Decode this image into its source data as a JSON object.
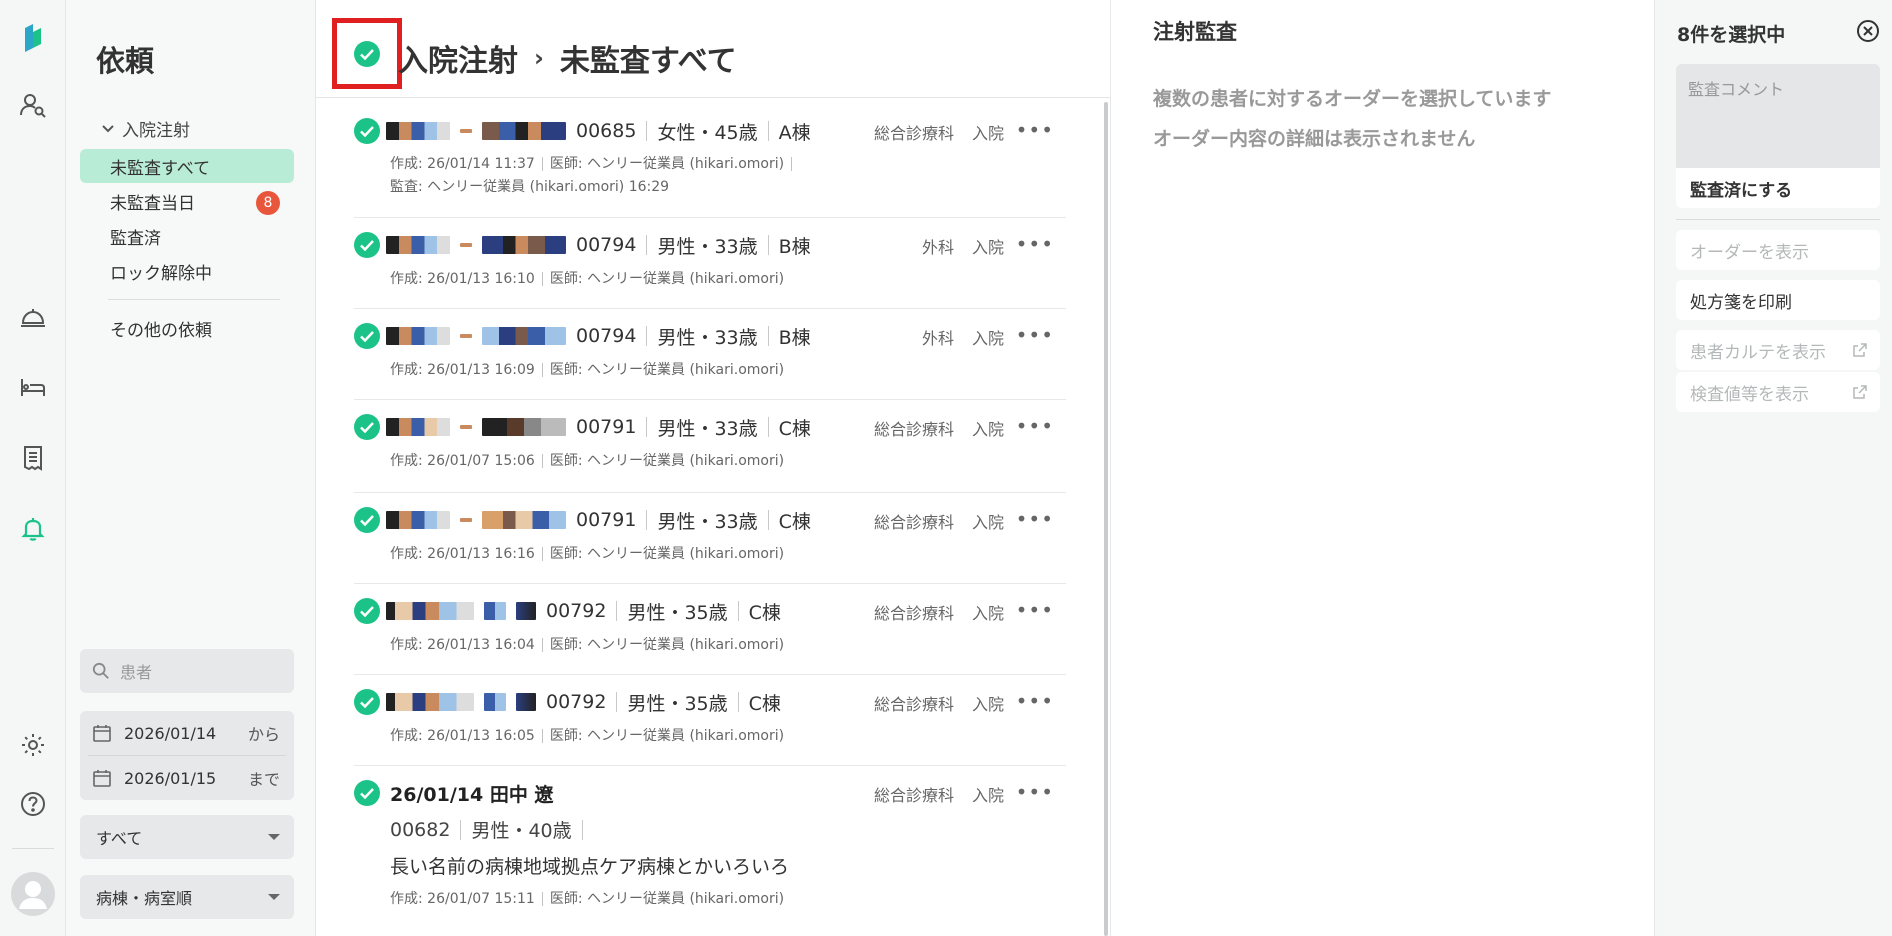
{
  "nav": {
    "title": "依頼",
    "group_label": "入院注射",
    "items": [
      {
        "label": "未監査すべて",
        "badge": null
      },
      {
        "label": "未監査当日",
        "badge": "8"
      },
      {
        "label": "監査済",
        "badge": null
      },
      {
        "label": "ロック解除中",
        "badge": null
      }
    ],
    "other_label": "その他の依頼",
    "search_placeholder": "患者",
    "date_from": "2026/01/14",
    "date_from_suffix": "から",
    "date_to": "2026/01/15",
    "date_to_suffix": "まで",
    "filter_value": "すべて",
    "sort_value": "病棟・病室順"
  },
  "main": {
    "title_parent": "入院注射",
    "title_chevron": "›",
    "title_child": "未監査すべて"
  },
  "rows": [
    {
      "id": "00685",
      "sex_age": "女性・45歳",
      "ward": "A棟",
      "dept": "総合診療科",
      "type": "入院",
      "meta1": "作成: 26/01/14 11:37",
      "meta2": "医師: ヘンリー従業員 (hikari.omori)",
      "meta3": "監査: ヘンリー従業員 (hikari.omori) 16:29"
    },
    {
      "id": "00794",
      "sex_age": "男性・33歳",
      "ward": "B棟",
      "dept": "外科",
      "type": "入院",
      "meta1": "作成: 26/01/13 16:10",
      "meta2": "医師: ヘンリー従業員 (hikari.omori)"
    },
    {
      "id": "00794",
      "sex_age": "男性・33歳",
      "ward": "B棟",
      "dept": "外科",
      "type": "入院",
      "meta1": "作成: 26/01/13 16:09",
      "meta2": "医師: ヘンリー従業員 (hikari.omori)"
    },
    {
      "id": "00791",
      "sex_age": "男性・33歳",
      "ward": "C棟",
      "dept": "総合診療科",
      "type": "入院",
      "meta1": "作成: 26/01/07 15:06",
      "meta2": "医師: ヘンリー従業員 (hikari.omori)"
    },
    {
      "id": "00791",
      "sex_age": "男性・33歳",
      "ward": "C棟",
      "dept": "総合診療科",
      "type": "入院",
      "meta1": "作成: 26/01/13 16:16",
      "meta2": "医師: ヘンリー従業員 (hikari.omori)"
    },
    {
      "id": "00792",
      "sex_age": "男性・35歳",
      "ward": "C棟",
      "dept": "総合診療科",
      "type": "入院",
      "meta1": "作成: 26/01/13 16:04",
      "meta2": "医師: ヘンリー従業員 (hikari.omori)"
    },
    {
      "id": "00792",
      "sex_age": "男性・35歳",
      "ward": "C棟",
      "dept": "総合診療科",
      "type": "入院",
      "meta1": "作成: 26/01/13 16:05",
      "meta2": "医師: ヘンリー従業員 (hikari.omori)"
    },
    {
      "title": "26/01/14 田中 遼",
      "id": "00682",
      "sex_age": "男性・40歳",
      "ward_long": "長い名前の病棟地域拠点ケア病棟とかいろいろ",
      "dept": "総合診療科",
      "type": "入院",
      "meta1": "作成: 26/01/07 15:11",
      "meta2": "医師: ヘンリー従業員 (hikari.omori)"
    }
  ],
  "detail": {
    "title": "注射監査",
    "message1": "複数の患者に対するオーダーを選択しています",
    "message2": "オーダー内容の詳細は表示されません"
  },
  "actions": {
    "selected_count": "8件を選択中",
    "comment_placeholder": "監査コメント",
    "approve_label": "監査済にする",
    "show_order_label": "オーダーを表示",
    "print_label": "処方箋を印刷",
    "chart_label": "患者カルテを表示",
    "lab_label": "検査値等を表示"
  },
  "colors": {
    "accent_green": "#1cc389",
    "active_nav_bg": "#b8ecd6",
    "badge_red": "#e8573c",
    "highlight_box": "#e02020"
  }
}
